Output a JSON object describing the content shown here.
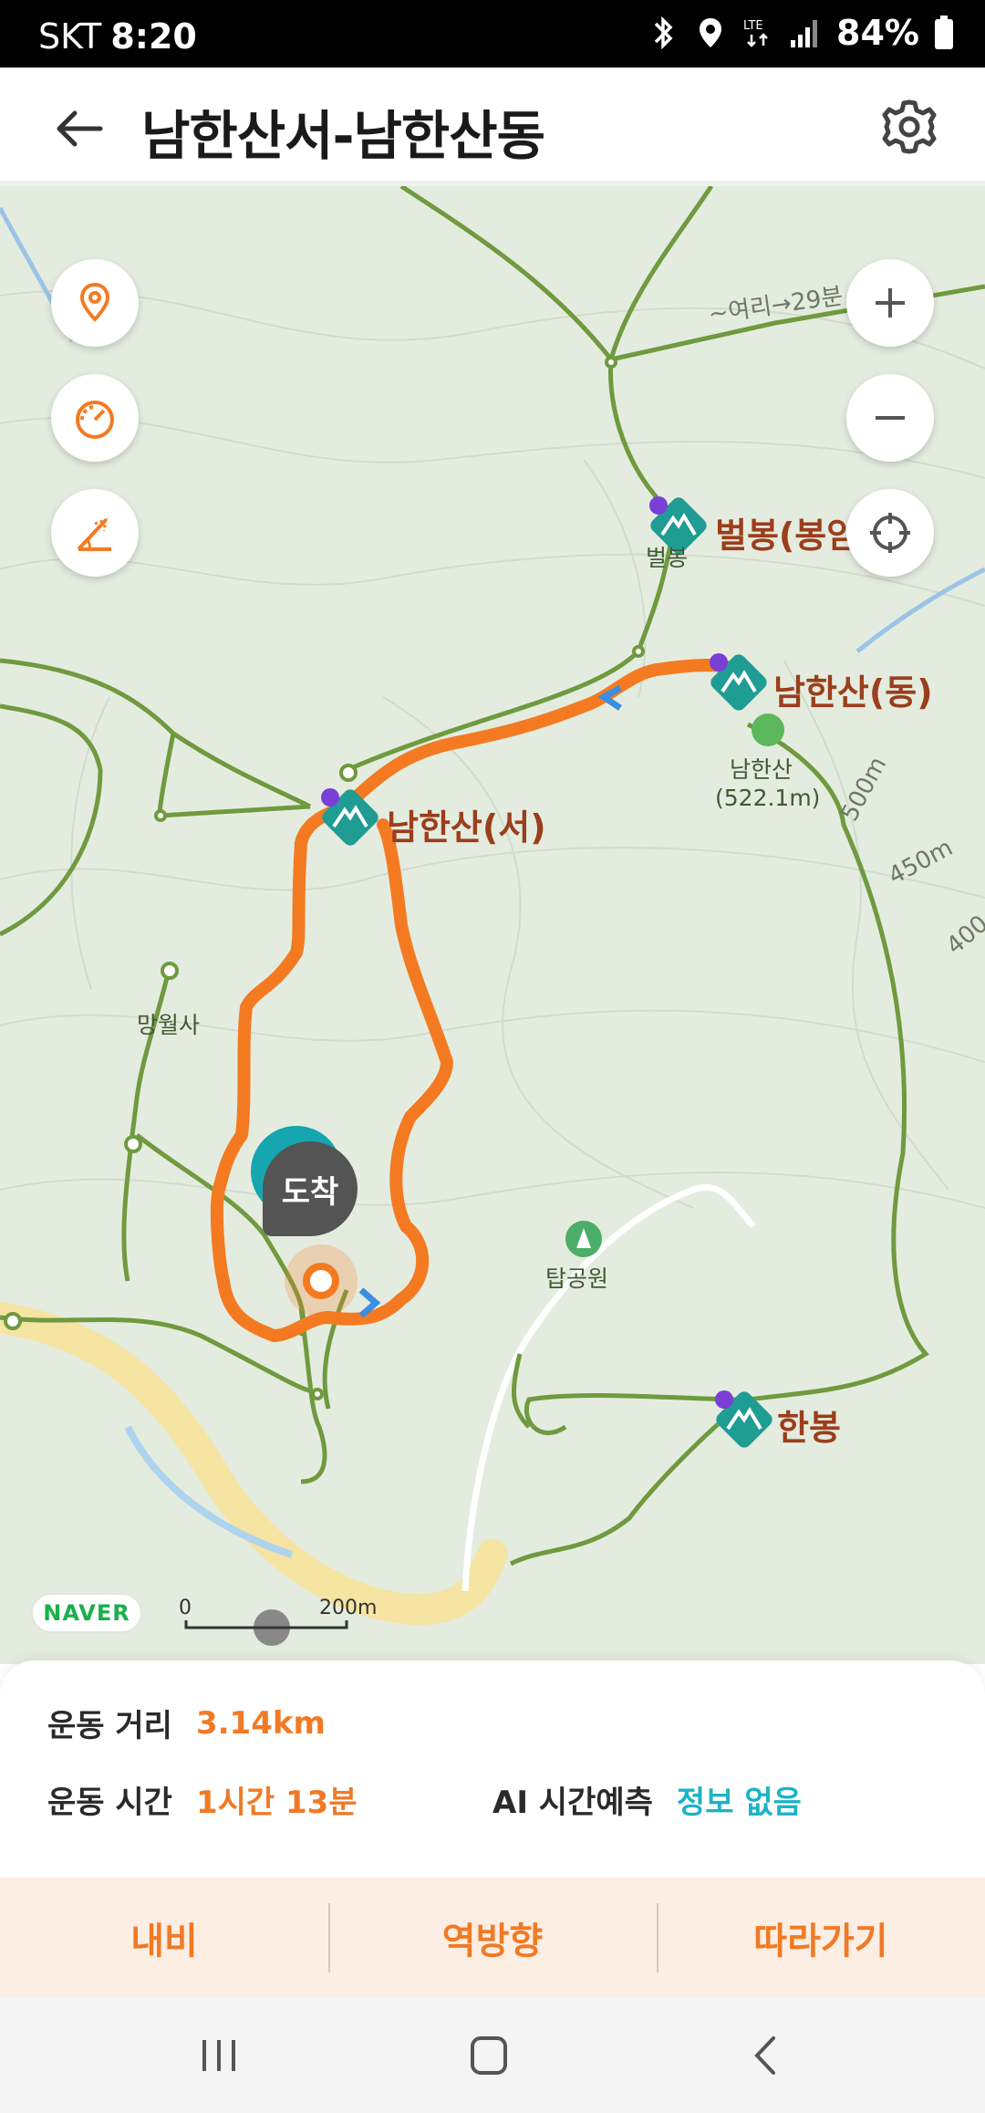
{
  "status_bar": {
    "carrier": "SKT",
    "time": "8:20",
    "network": "LTE",
    "battery": "84%",
    "icons": [
      "bluetooth-icon",
      "location-icon",
      "lte-icon",
      "signal-icon",
      "battery-icon"
    ]
  },
  "header": {
    "title": "남한산서-남한산동",
    "back_icon": "back-arrow-icon",
    "settings_icon": "gear-icon"
  },
  "map": {
    "left_controls": [
      "location-pin-icon",
      "speedometer-icon",
      "elevation-icon"
    ],
    "right_controls": [
      "zoom-in-icon",
      "zoom-out-icon",
      "crosshair-icon"
    ],
    "peaks": {
      "beolbong": "벌봉(봉암",
      "beolbong_small": "벌봉",
      "namhansan_east": "남한산(동)",
      "namhansan_west": "남한산(서)",
      "hanbong": "한봉"
    },
    "summit_name": "남한산",
    "summit_height": "(522.1m)",
    "places": {
      "mangwolsa": "망월사",
      "tapgongwon": "탑공원"
    },
    "contours": {
      "c500": "500m",
      "c450": "450m",
      "c400": "400"
    },
    "trail_text": "~여리→29분",
    "arrive_label": "도착",
    "brand": "NAVER",
    "scale_zero": "0",
    "scale_max": "200m",
    "route_color": "#F47A22",
    "peak_color": "#1F9C93"
  },
  "info": {
    "distance_label": "운동 거리",
    "distance_value": "3.14km",
    "time_label": "운동 시간",
    "time_value": "1시간 13분",
    "ai_label": "AI 시간예측",
    "ai_value": "정보 없음"
  },
  "actions": {
    "navi": "내비",
    "reverse": "역방향",
    "follow": "따라가기"
  },
  "nav_bar": [
    "recent-apps-icon",
    "home-icon",
    "back-icon"
  ]
}
